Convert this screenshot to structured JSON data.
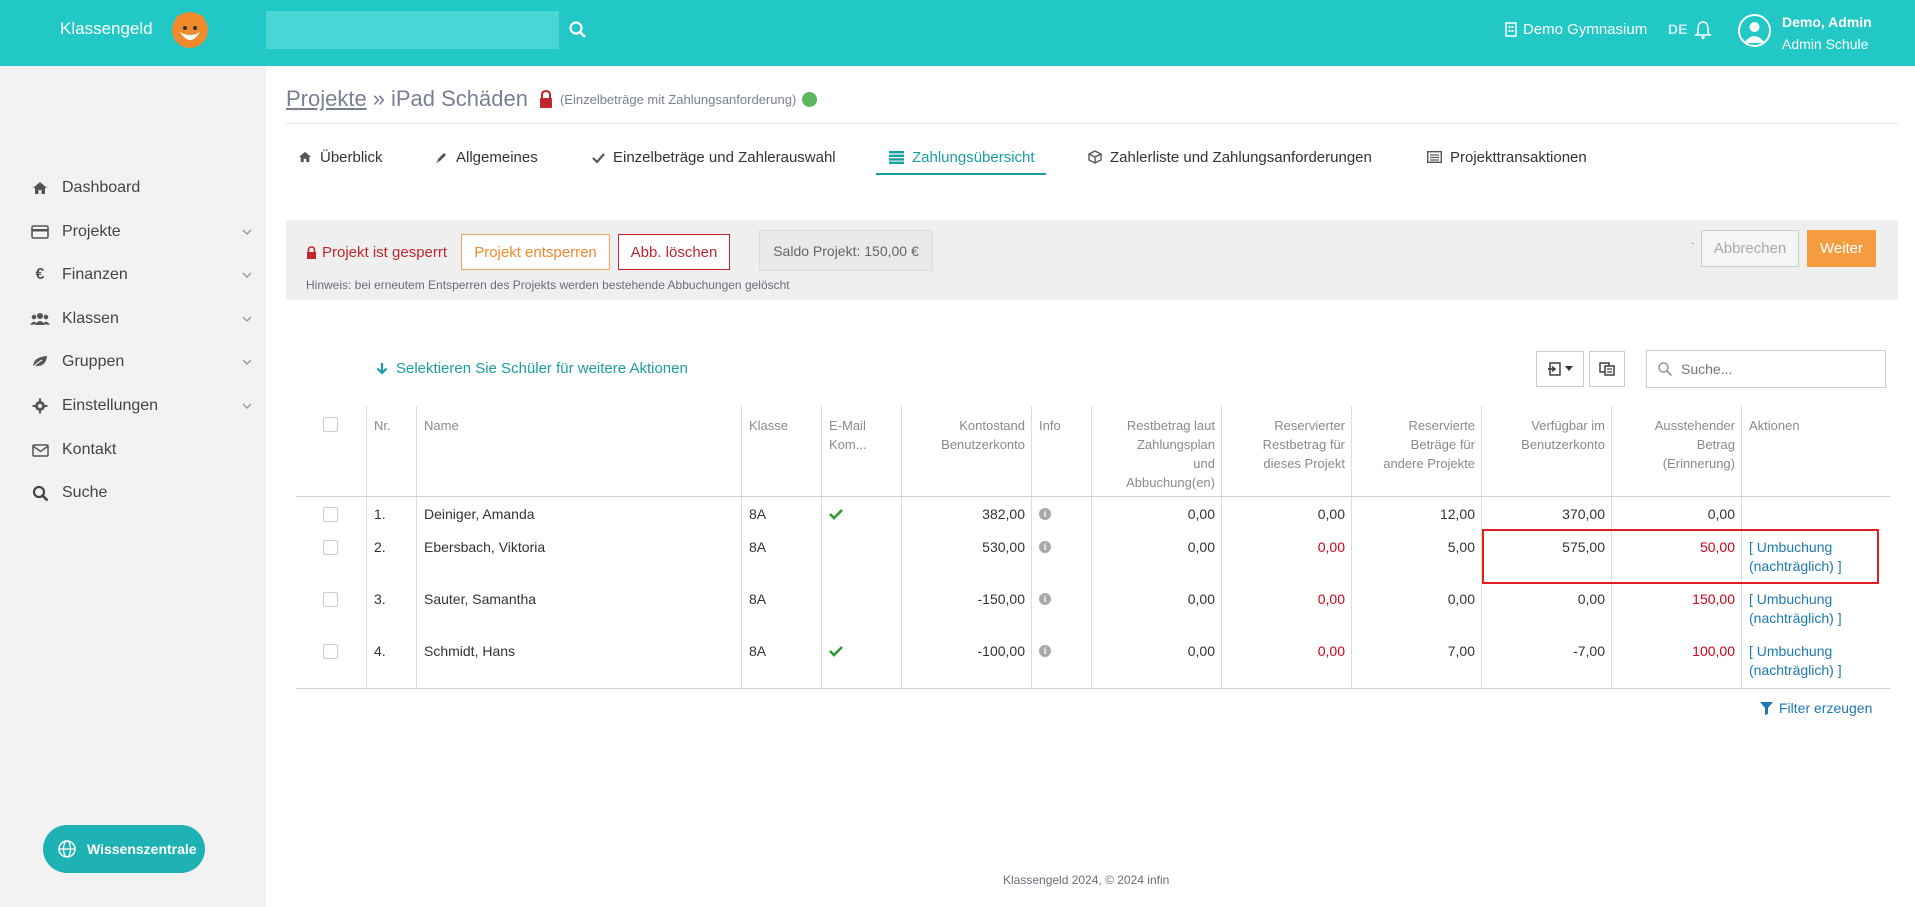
{
  "app": {
    "brand": "Klassengeld",
    "school": "Demo Gymnasium",
    "lang": "DE",
    "user_name": "Demo, Admin",
    "user_role": "Admin Schule"
  },
  "sidebar": {
    "items": [
      {
        "label": "Dashboard",
        "icon": "home-icon"
      },
      {
        "label": "Projekte",
        "icon": "card-icon"
      },
      {
        "label": "Finanzen",
        "icon": "euro-icon"
      },
      {
        "label": "Klassen",
        "icon": "users-icon"
      },
      {
        "label": "Gruppen",
        "icon": "leaf-icon"
      },
      {
        "label": "Einstellungen",
        "icon": "gear-icon"
      },
      {
        "label": "Kontakt",
        "icon": "mail-icon"
      },
      {
        "label": "Suche",
        "icon": "search-icon"
      }
    ],
    "help_label": "Wissenszentrale"
  },
  "breadcrumb": {
    "root": "Projekte",
    "sep": "»",
    "current": "iPad Schäden",
    "note": "(Einzelbeträge mit Zahlungsanforderung)"
  },
  "tabs": [
    {
      "label": "Überblick"
    },
    {
      "label": "Allgemeines"
    },
    {
      "label": "Einzelbeträge und Zahlerauswahl"
    },
    {
      "label": "Zahlungsübersicht"
    },
    {
      "label": "Zahlerliste und Zahlungsanforderungen"
    },
    {
      "label": "Projekttransaktionen"
    }
  ],
  "toolbar": {
    "locked_text": "Projekt ist gesperrt",
    "unlock_label": "Projekt entsperren",
    "delete_label": "Abb. löschen",
    "saldo": "Saldo Projekt: 150,00 €",
    "hint": "Hinweis: bei erneutem Entsperren des Projekts werden bestehende Abbuchungen gelöscht",
    "cancel_label": "Abbrechen",
    "next_label": "Weiter",
    "dot": "·"
  },
  "table_tools": {
    "select_hint": "Selektieren Sie Schüler für weitere Aktionen",
    "search_placeholder": "Suche..."
  },
  "table": {
    "headers": {
      "nr": "Nr.",
      "name": "Name",
      "klasse": "Klasse",
      "email": [
        "E-Mail",
        "Kom..."
      ],
      "konto": [
        "Kontostand",
        "Benutzerkonto"
      ],
      "info": "Info",
      "rest": [
        "Restbetrag laut",
        "Zahlungsplan",
        "und",
        "Abbuchung(en)"
      ],
      "resproj": [
        "Reservierter",
        "Restbetrag für",
        "dieses Projekt"
      ],
      "resother": [
        "Reservierte",
        "Beträge für",
        "andere Projekte"
      ],
      "verf": [
        "Verfügbar im",
        "Benutzerkonto"
      ],
      "aus": [
        "Ausstehender",
        "Betrag",
        "(Erinnerung)"
      ],
      "aktionen": "Aktionen"
    },
    "rows": [
      {
        "nr": "1.",
        "name": "Deiniger, Amanda",
        "klasse": "8A",
        "email": true,
        "konto": "382,00",
        "rest": "0,00",
        "resproj": "0,00",
        "resproj_red": false,
        "resother": "12,00",
        "verf": "370,00",
        "aus": "0,00",
        "aus_red": false,
        "action1": "",
        "action2": ""
      },
      {
        "nr": "2.",
        "name": "Ebersbach, Viktoria",
        "klasse": "8A",
        "email": false,
        "konto": "530,00",
        "rest": "0,00",
        "resproj": "0,00",
        "resproj_red": true,
        "resother": "5,00",
        "verf": "575,00",
        "aus": "50,00",
        "aus_red": true,
        "action1": "[ Umbuchung",
        "action2": "(nachträglich) ]"
      },
      {
        "nr": "3.",
        "name": "Sauter, Samantha",
        "klasse": "8A",
        "email": false,
        "konto": "-150,00",
        "rest": "0,00",
        "resproj": "0,00",
        "resproj_red": true,
        "resother": "0,00",
        "verf": "0,00",
        "aus": "150,00",
        "aus_red": true,
        "action1": "[ Umbuchung",
        "action2": "(nachträglich) ]"
      },
      {
        "nr": "4.",
        "name": "Schmidt, Hans",
        "klasse": "8A",
        "email": true,
        "konto": "-100,00",
        "rest": "0,00",
        "resproj": "0,00",
        "resproj_red": true,
        "resother": "7,00",
        "verf": "-7,00",
        "aus": "100,00",
        "aus_red": true,
        "action1": "[ Umbuchung",
        "action2": "(nachträglich) ]"
      }
    ]
  },
  "filter_label": "Filter erzeugen",
  "footer": "Klassengeld 2024, © 2024 infin",
  "colors": {
    "accent": "#21c8c6",
    "active_tab": "#1a9ea2",
    "danger": "#d0021b",
    "warning": "#f59c40"
  }
}
